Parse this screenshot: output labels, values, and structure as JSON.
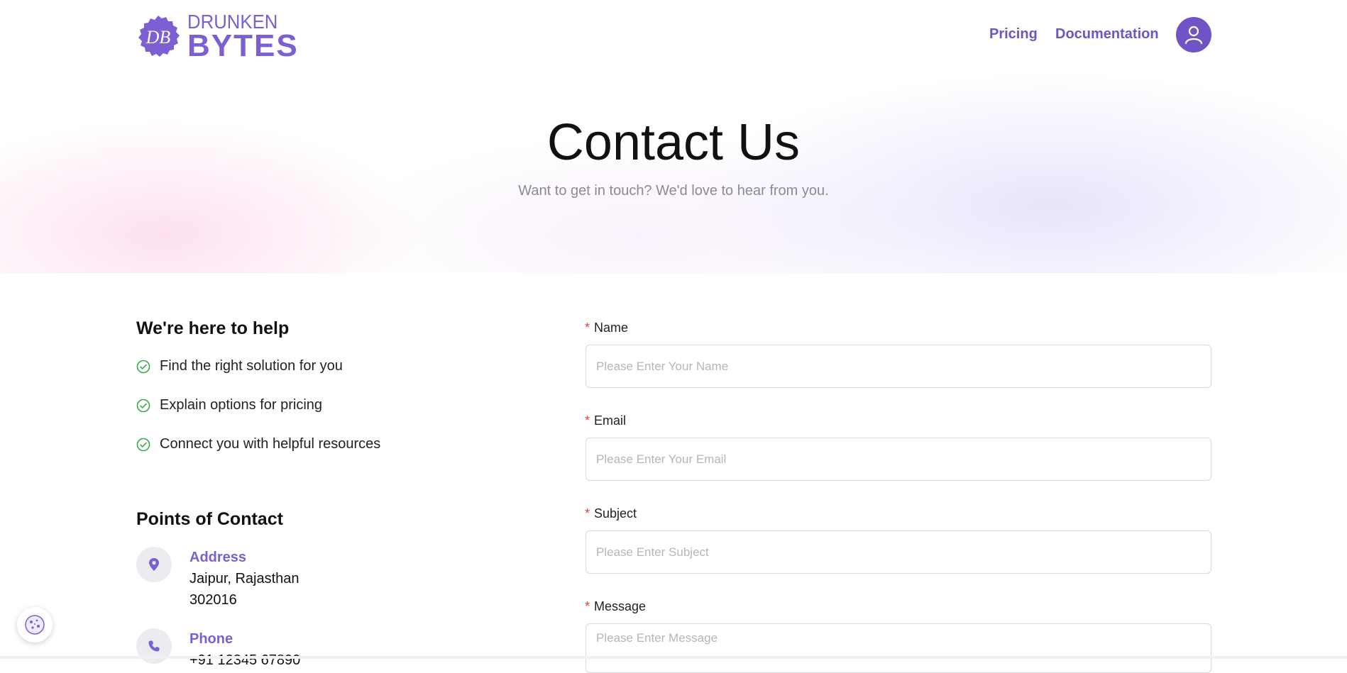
{
  "brand": {
    "line1": "DRUNKEN",
    "line2": "BYTES",
    "monogram": "DB",
    "color": "#7b5fd3"
  },
  "nav": {
    "pricing": "Pricing",
    "documentation": "Documentation",
    "avatar_icon": "user-icon"
  },
  "hero": {
    "title": "Contact Us",
    "subtitle": "Want to get in touch? We'd love to hear from you."
  },
  "help": {
    "title": "We're here to help",
    "items": [
      "Find the right solution for you",
      "Explain options for pricing",
      "Connect you with helpful resources"
    ]
  },
  "contact": {
    "title": "Points of Contact",
    "address": {
      "label": "Address",
      "line1": "Jaipur, Rajasthan",
      "line2": "302016"
    },
    "phone": {
      "label": "Phone",
      "value": "+91 12345 67890"
    }
  },
  "form": {
    "required_marker": "*",
    "name": {
      "label": "Name",
      "placeholder": "Please Enter Your Name"
    },
    "email": {
      "label": "Email",
      "placeholder": "Please Enter Your Email"
    },
    "subject": {
      "label": "Subject",
      "placeholder": "Please Enter Subject"
    },
    "message": {
      "label": "Message",
      "placeholder": "Please Enter Message"
    }
  },
  "colors": {
    "accent": "#6f54c6",
    "required": "#e0453c",
    "check": "#3aa84a"
  }
}
